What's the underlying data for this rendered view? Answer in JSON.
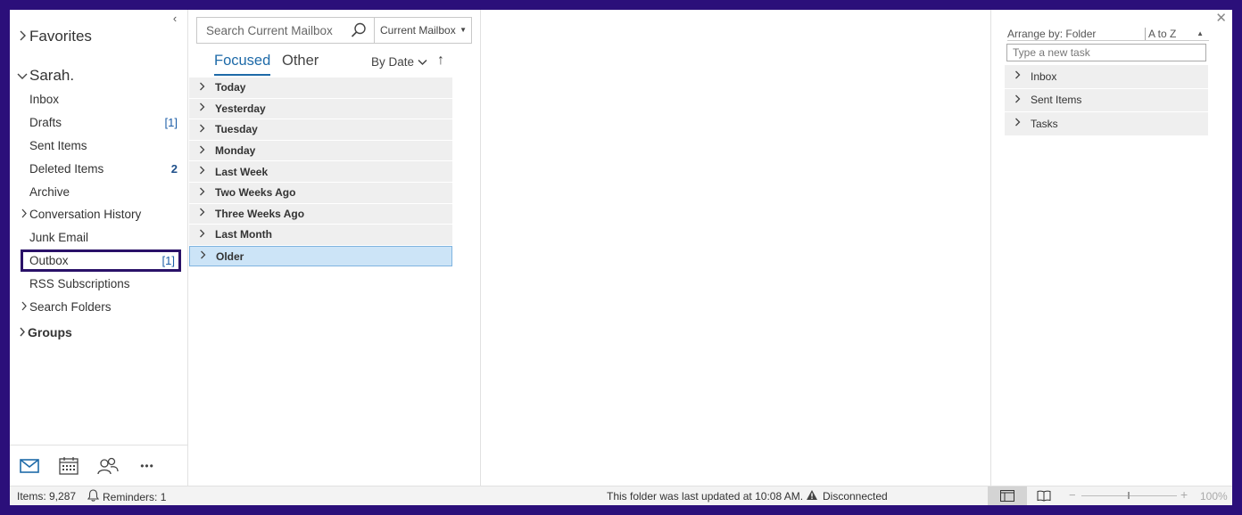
{
  "folder_pane": {
    "favorites_label": "Favorites",
    "account_label": "Sarah.",
    "folders": [
      {
        "label": "Inbox",
        "count": "",
        "chevron": false
      },
      {
        "label": "Drafts",
        "count": "[1]",
        "chevron": false
      },
      {
        "label": "Sent Items",
        "count": "",
        "chevron": false
      },
      {
        "label": "Deleted Items",
        "count": "2",
        "chevron": false
      },
      {
        "label": "Archive",
        "count": "",
        "chevron": false
      },
      {
        "label": "Conversation History",
        "count": "",
        "chevron": true
      },
      {
        "label": "Junk Email",
        "count": "",
        "chevron": false
      },
      {
        "label": "Outbox",
        "count": "[1]",
        "chevron": false
      },
      {
        "label": "RSS Subscriptions",
        "count": "",
        "chevron": false
      },
      {
        "label": "Search Folders",
        "count": "",
        "chevron": true
      }
    ],
    "groups_label": "Groups",
    "collapse_glyph": "‹"
  },
  "nav_bar": {
    "icons": [
      "mail-icon",
      "calendar-icon",
      "people-icon",
      "more-icon"
    ],
    "more_glyph": "•••"
  },
  "mail_list": {
    "search_placeholder": "Search Current Mailbox",
    "scope_label": "Current Mailbox",
    "tab_focused": "Focused",
    "tab_other": "Other",
    "sort_by_label": "By Date",
    "sort_direction_glyph": "↑",
    "groups": [
      "Today",
      "Yesterday",
      "Tuesday",
      "Monday",
      "Last Week",
      "Two Weeks Ago",
      "Three Weeks Ago",
      "Last Month",
      "Older"
    ],
    "selected_group": "Older"
  },
  "todo_bar": {
    "arrange_label": "Arrange by: Folder",
    "order_label": "A to Z",
    "task_placeholder": "Type a new task",
    "groups": [
      "Inbox",
      "Sent Items",
      "Tasks"
    ]
  },
  "status_bar": {
    "items_text": "Items: 9,287",
    "reminders_text": "Reminders: 1",
    "updated_text": "This folder was last updated at 10:08 AM.",
    "connection_text": "Disconnected",
    "zoom_level": "100%"
  },
  "colors": {
    "accent": "#1e6aa8",
    "selection_bg": "#cce4f7",
    "highlight_box": "#2a1168",
    "frame": "#2b0f7a"
  }
}
